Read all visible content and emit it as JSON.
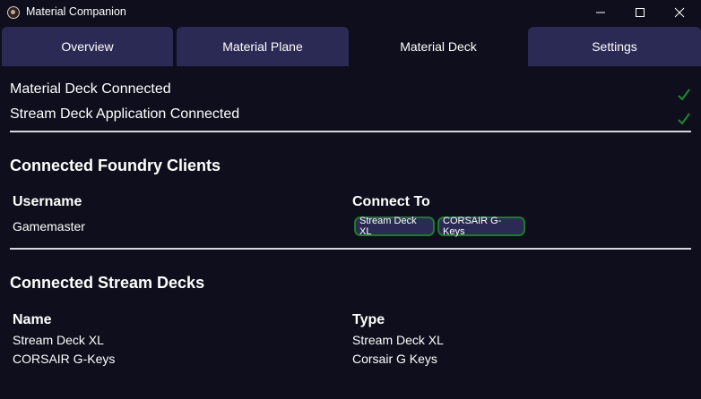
{
  "window": {
    "title": "Material Companion",
    "icon": "app-logo-icon",
    "controls": [
      "minimize-icon",
      "maximize-icon",
      "close-icon"
    ]
  },
  "tabs": [
    {
      "label": "Overview",
      "active": false
    },
    {
      "label": "Material Plane",
      "active": false
    },
    {
      "label": "Material Deck",
      "active": true
    },
    {
      "label": "Settings",
      "active": false
    }
  ],
  "status": [
    {
      "text": "Material Deck Connected",
      "ok": true
    },
    {
      "text": "Stream Deck Application Connected",
      "ok": true
    }
  ],
  "foundry": {
    "title": "Connected Foundry Clients",
    "headers": {
      "username": "Username",
      "connect_to": "Connect To"
    },
    "rows": [
      {
        "username": "Gamemaster",
        "targets": [
          "Stream Deck XL",
          "CORSAIR G-Keys"
        ]
      }
    ]
  },
  "decks": {
    "title": "Connected Stream Decks",
    "headers": {
      "name": "Name",
      "type": "Type"
    },
    "rows": [
      {
        "name": "Stream Deck XL",
        "type": "Stream Deck XL"
      },
      {
        "name": "CORSAIR G-Keys",
        "type": "Corsair G Keys"
      }
    ]
  },
  "colors": {
    "background": "#0e0e1c",
    "tab": "#2a2a55",
    "check": "#1f8a2e",
    "chip_border": "#1f7a2e"
  }
}
